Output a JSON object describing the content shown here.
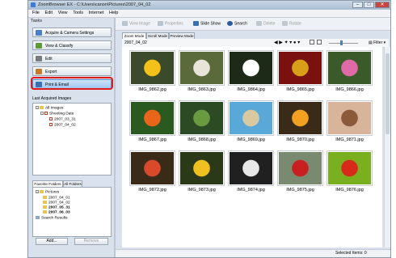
{
  "window": {
    "title": "ZoomBrowser EX - C:\\Users\\canon\\Pictures\\2007_04_02",
    "btn_min": "–",
    "btn_max": "□",
    "btn_close": "✕"
  },
  "menu": [
    "File",
    "Edit",
    "View",
    "Tools",
    "Internet",
    "Help"
  ],
  "tasks": {
    "header": "Tasks",
    "items": [
      {
        "label": "Acquire & Camera Settings",
        "color": "#4a7fc1"
      },
      {
        "label": "View & Classify",
        "color": "#5c9a3a"
      },
      {
        "label": "Edit",
        "color": "#7a7a7a"
      },
      {
        "label": "Export",
        "color": "#c47a2a"
      },
      {
        "label": "Print & Email",
        "color": "#3a6fb0"
      }
    ]
  },
  "last_acquired": {
    "header": "Last Acquired Images",
    "tree": [
      "All Images",
      "Shooting Date",
      "2007_03_31",
      "2007_04_02"
    ]
  },
  "favorites": {
    "tab_folders": "Favorite Folders",
    "tab_all": "All Folders",
    "tree": [
      "Pictures",
      "2007_04_01",
      "2007_04_02",
      "2007_05_31",
      "2007_06_03",
      "Search Results"
    ],
    "add": "Add...",
    "remove": "Remove"
  },
  "toolbar": {
    "view_image": "View Image",
    "properties": "Properties",
    "slide_show": "Slide Show",
    "search": "Search",
    "delete": "Delete",
    "rotate": "Rotate",
    "filter": "Filter"
  },
  "tabs": [
    "Zoom Mode",
    "Scroll Mode",
    "Preview Mode"
  ],
  "folder": "2007_04_02",
  "images": [
    {
      "name": "IMG_9862.jpg",
      "bg": "#3a4a2a",
      "fg": "#f2c21b"
    },
    {
      "name": "IMG_9863.jpg",
      "bg": "#5a6a3a",
      "fg": "#e8e4d8"
    },
    {
      "name": "IMG_9864.jpg",
      "bg": "#1e2a18",
      "fg": "#ffffff"
    },
    {
      "name": "IMG_9865.jpg",
      "bg": "#7a1010",
      "fg": "#d8a018"
    },
    {
      "name": "IMG_9866.jpg",
      "bg": "#3a5a2a",
      "fg": "#e06aa8"
    },
    {
      "name": "IMG_9867.jpg",
      "bg": "#2a5a20",
      "fg": "#e8651a"
    },
    {
      "name": "IMG_9868.jpg",
      "bg": "#2c4a24",
      "fg": "#6a9a40"
    },
    {
      "name": "IMG_9869.jpg",
      "bg": "#5aa8d8",
      "fg": "#d8c9a0"
    },
    {
      "name": "IMG_9870.jpg",
      "bg": "#3a2a18",
      "fg": "#f2a020"
    },
    {
      "name": "IMG_9871.jpg",
      "bg": "#d8b49a",
      "fg": "#8a5a3a"
    },
    {
      "name": "IMG_9872.jpg",
      "bg": "#3a2a18",
      "fg": "#d84a2a"
    },
    {
      "name": "IMG_9873.jpg",
      "bg": "#2a3a18",
      "fg": "#f0c020"
    },
    {
      "name": "IMG_9874.jpg",
      "bg": "#202020",
      "fg": "#e8e8e8"
    },
    {
      "name": "IMG_9875.jpg",
      "bg": "#7a8a70",
      "fg": "#c82020"
    },
    {
      "name": "IMG_9876.jpg",
      "bg": "#7ab020",
      "fg": "#d82a1a"
    }
  ],
  "status": {
    "selected": "Selected Items: 0"
  }
}
